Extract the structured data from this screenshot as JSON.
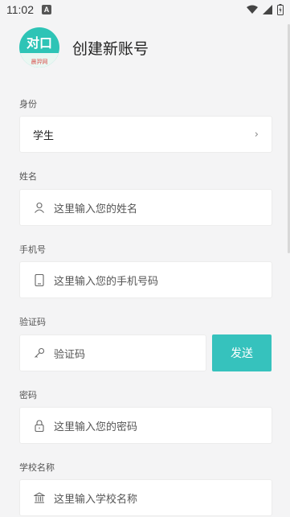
{
  "status_bar": {
    "time": "11:02",
    "notification_letter": "A"
  },
  "header": {
    "logo_main": "对口",
    "logo_sub": "晨羿网",
    "title": "创建新账号"
  },
  "identity": {
    "label": "身份",
    "value": "学生",
    "chevron": "›"
  },
  "name": {
    "label": "姓名",
    "placeholder": "这里输入您的姓名"
  },
  "phone": {
    "label": "手机号",
    "placeholder": "这里输入您的手机号码"
  },
  "code": {
    "label": "验证码",
    "placeholder": "验证码",
    "send_label": "发送"
  },
  "password": {
    "label": "密码",
    "placeholder": "这里输入您的密码"
  },
  "school": {
    "label": "学校名称",
    "placeholder": "这里输入学校名称"
  },
  "colors": {
    "accent": "#36c2bd",
    "background": "#f4f4f5",
    "field": "#ffffff"
  },
  "icons": {
    "name": "person-icon",
    "phone": "phone-icon",
    "code": "key-icon",
    "password": "lock-icon",
    "school": "school-icon"
  }
}
